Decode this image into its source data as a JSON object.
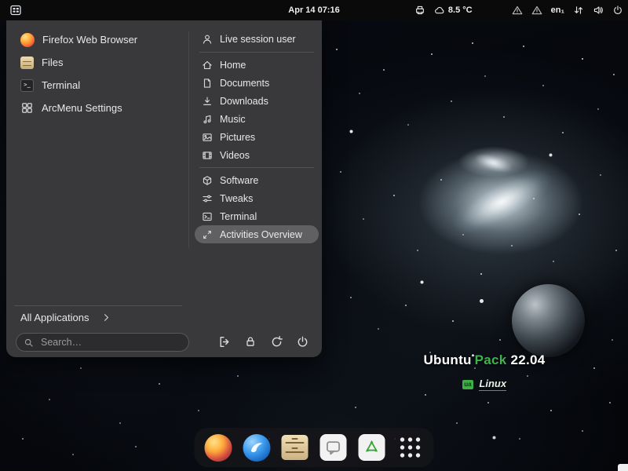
{
  "topbar": {
    "clock": "Apr 14 07:16",
    "weather": {
      "icon": "cloud-icon",
      "temp": "8.5 °C"
    },
    "keyboard_layout": "en₁",
    "icons": [
      "printer-icon",
      "warning-icon",
      "warning-icon",
      "network-icon",
      "volume-icon",
      "power-icon"
    ],
    "menu_button_icon": "arcmenu-icon"
  },
  "menu": {
    "pinned_apps": [
      {
        "label": "Firefox Web Browser",
        "icon": "firefox-icon"
      },
      {
        "label": "Files",
        "icon": "files-icon"
      },
      {
        "label": "Terminal",
        "icon": "terminal-icon"
      },
      {
        "label": "ArcMenu Settings",
        "icon": "arcmenu-settings-icon"
      }
    ],
    "user_label": "Live session user",
    "places": [
      {
        "label": "Home",
        "icon": "home-icon"
      },
      {
        "label": "Documents",
        "icon": "document-icon"
      },
      {
        "label": "Downloads",
        "icon": "download-icon"
      },
      {
        "label": "Music",
        "icon": "music-icon"
      },
      {
        "label": "Pictures",
        "icon": "picture-icon"
      },
      {
        "label": "Videos",
        "icon": "video-icon"
      }
    ],
    "shortcuts": [
      {
        "label": "Software",
        "icon": "software-icon",
        "highlighted": false
      },
      {
        "label": "Tweaks",
        "icon": "tweaks-icon",
        "highlighted": false
      },
      {
        "label": "Terminal",
        "icon": "terminal-icon",
        "highlighted": false
      },
      {
        "label": "Activities Overview",
        "icon": "activities-icon",
        "highlighted": true
      }
    ],
    "all_applications_label": "All Applications",
    "search_placeholder": "Search…",
    "session_buttons": [
      "logout-icon",
      "lock-icon",
      "restart-icon",
      "power-icon"
    ]
  },
  "desktop": {
    "brand": {
      "name1": "Ubuntu",
      "mark": "*",
      "name2": "Pack",
      "version": "22.04",
      "accent_color": "#3cb44a"
    },
    "logo": {
      "badge": "ua",
      "text": "Linux"
    }
  },
  "dock": {
    "items": [
      {
        "name": "firefox",
        "icon": "firefox-icon"
      },
      {
        "name": "thunderbird",
        "icon": "thunderbird-icon"
      },
      {
        "name": "files",
        "icon": "files-icon"
      },
      {
        "name": "messages",
        "icon": "chat-icon"
      },
      {
        "name": "software",
        "icon": "software-center-icon"
      },
      {
        "name": "show-apps",
        "icon": "app-grid-icon"
      }
    ]
  }
}
